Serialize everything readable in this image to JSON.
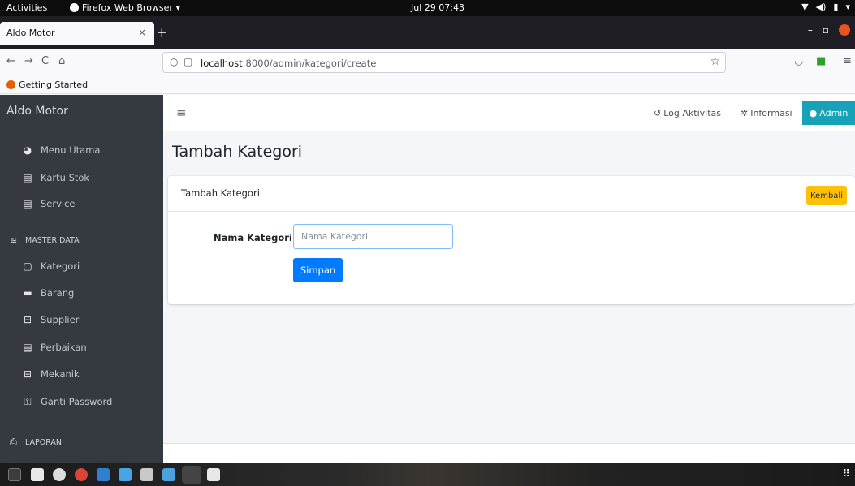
{
  "system": {
    "activities": "Activities",
    "app_menu": "Firefox Web Browser ▾",
    "clock": "Jul 29  07:43",
    "tray": [
      "▼",
      "◀)",
      "▮",
      "▾"
    ]
  },
  "browser": {
    "tab_title": "Aldo Motor",
    "tab_close": "×",
    "new_tab": "+",
    "url_host": "localhost",
    "url_path": ":8000/admin/kategori/create",
    "bookmark": "Getting Started",
    "nav_icons": {
      "back": "←",
      "forward": "→",
      "reload": "C",
      "home": "⌂",
      "star": "☆",
      "menu": "≡",
      "pocket": "◡"
    },
    "win_controls": {
      "minimize": "–",
      "maximize": "▫"
    }
  },
  "sidebar": {
    "brand": "Aldo Motor",
    "items": [
      {
        "label": "Menu Utama",
        "icon": "tachometer-icon",
        "glyph": "◕"
      },
      {
        "label": "Kartu Stok",
        "icon": "file-icon",
        "glyph": "▤"
      },
      {
        "label": "Service",
        "icon": "file-icon",
        "glyph": "▤"
      },
      {
        "label": "Kategori",
        "icon": "file-outline-icon",
        "glyph": "▢"
      },
      {
        "label": "Barang",
        "icon": "box-icon",
        "glyph": "▬"
      },
      {
        "label": "Supplier",
        "icon": "id-card-icon",
        "glyph": "⊟"
      },
      {
        "label": "Perbaikan",
        "icon": "file-icon",
        "glyph": "▤"
      },
      {
        "label": "Mekanik",
        "icon": "id-card-icon",
        "glyph": "⊟"
      },
      {
        "label": "Ganti Password",
        "icon": "key-icon",
        "glyph": "⚿"
      }
    ],
    "headers": [
      {
        "label": "MASTER DATA",
        "icon": "database-icon",
        "glyph": "≋"
      },
      {
        "label": "LAPORAN",
        "icon": "print-icon",
        "glyph": "⎙"
      }
    ]
  },
  "topnav": {
    "hamburger": "≡",
    "log_label": "Log Aktivitas",
    "log_glyph": "↺",
    "info_label": "Informasi",
    "info_glyph": "✲",
    "admin_label": "Admin",
    "admin_glyph": "●"
  },
  "page": {
    "title": "Tambah Kategori",
    "card_title": "Tambah Kategori",
    "back_button": "Kembali",
    "field_label": "Nama Kategori :",
    "field_placeholder": "Nama Kategori",
    "field_value": "",
    "submit_button": "Simpan"
  },
  "colors": {
    "sidebar_bg": "#343a40",
    "admin_bg": "#17a2b8",
    "warning": "#ffc107",
    "primary": "#007bff"
  }
}
